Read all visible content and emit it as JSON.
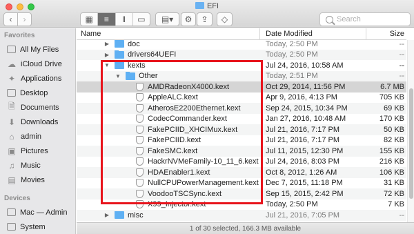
{
  "window": {
    "title": "EFI"
  },
  "toolbar": {
    "back_icon": "chevron-left-icon",
    "forward_icon": "chevron-right-icon",
    "search_placeholder": "Search"
  },
  "sidebar": {
    "favorites_heading": "Favorites",
    "favorites": [
      {
        "label": "All My Files",
        "icon": "all-files-icon"
      },
      {
        "label": "iCloud Drive",
        "icon": "cloud-icon"
      },
      {
        "label": "Applications",
        "icon": "applications-icon"
      },
      {
        "label": "Desktop",
        "icon": "desktop-icon"
      },
      {
        "label": "Documents",
        "icon": "documents-icon"
      },
      {
        "label": "Downloads",
        "icon": "downloads-icon"
      },
      {
        "label": "admin",
        "icon": "home-icon"
      },
      {
        "label": "Pictures",
        "icon": "pictures-icon"
      },
      {
        "label": "Music",
        "icon": "music-icon"
      },
      {
        "label": "Movies",
        "icon": "movies-icon"
      }
    ],
    "devices_heading": "Devices",
    "devices": [
      {
        "label": "Mac — Admin",
        "icon": "computer-icon"
      },
      {
        "label": "System",
        "icon": "disk-icon"
      }
    ]
  },
  "columns": {
    "name": "Name",
    "date": "Date Modified",
    "size": "Size"
  },
  "rows": [
    {
      "name": "doc",
      "date": "Today, 2:50 PM",
      "size": "--",
      "kind": "folder"
    },
    {
      "name": "drivers64UEFI",
      "date": "Today, 2:50 PM",
      "size": "--",
      "kind": "folder"
    },
    {
      "name": "kexts",
      "date": "Jul 24, 2016, 10:58 AM",
      "size": "--",
      "kind": "folder"
    },
    {
      "name": "Other",
      "date": "Today, 2:51 PM",
      "size": "--",
      "kind": "folder"
    },
    {
      "name": "AMDRadeonX4000.kext",
      "date": "Oct 29, 2014, 11:56 PM",
      "size": "6.7 MB",
      "kind": "kext"
    },
    {
      "name": "AppleALC.kext",
      "date": "Apr 9, 2016, 4:13 PM",
      "size": "705 KB",
      "kind": "kext"
    },
    {
      "name": "AtherosE2200Ethernet.kext",
      "date": "Sep 24, 2015, 10:34 PM",
      "size": "69 KB",
      "kind": "kext"
    },
    {
      "name": "CodecCommander.kext",
      "date": "Jan 27, 2016, 10:48 AM",
      "size": "170 KB",
      "kind": "kext"
    },
    {
      "name": "FakePCIID_XHCIMux.kext",
      "date": "Jul 21, 2016, 7:17 PM",
      "size": "50 KB",
      "kind": "kext"
    },
    {
      "name": "FakePCIID.kext",
      "date": "Jul 21, 2016, 7:17 PM",
      "size": "82 KB",
      "kind": "kext"
    },
    {
      "name": "FakeSMC.kext",
      "date": "Jul 11, 2015, 12:30 PM",
      "size": "155 KB",
      "kind": "kext"
    },
    {
      "name": "HackrNVMeFamily-10_11_6.kext",
      "date": "Jul 24, 2016, 8:03 PM",
      "size": "216 KB",
      "kind": "kext"
    },
    {
      "name": "HDAEnabler1.kext",
      "date": "Oct 8, 2012, 1:26 AM",
      "size": "106 KB",
      "kind": "kext"
    },
    {
      "name": "NullCPUPowerManagement.kext",
      "date": "Dec 7, 2015, 11:18 PM",
      "size": "31 KB",
      "kind": "kext"
    },
    {
      "name": "VoodooTSCSync.kext",
      "date": "Sep 15, 2015, 2:42 PM",
      "size": "72 KB",
      "kind": "kext"
    },
    {
      "name": "X99_Injector.kext",
      "date": "Today, 2:50 PM",
      "size": "7 KB",
      "kind": "kext"
    },
    {
      "name": "misc",
      "date": "Jul 21, 2016, 7:05 PM",
      "size": "--",
      "kind": "folder"
    }
  ],
  "status": "1 of 30 selected, 166.3 MB available",
  "colors": {
    "highlight": "#e8141c",
    "folder": "#5fb0f3"
  }
}
